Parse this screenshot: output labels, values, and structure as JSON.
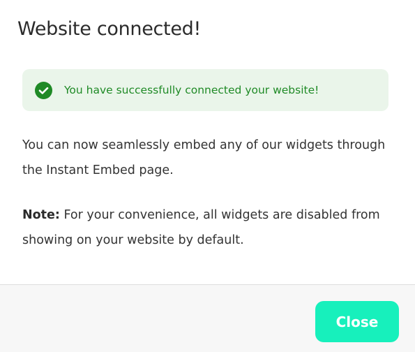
{
  "dialog": {
    "title": "Website connected!",
    "alert": {
      "icon": "check-circle-icon",
      "text": "You have successfully connected your website!",
      "text_color": "#1f8a26",
      "background_color": "#eaf5ea"
    },
    "body": {
      "paragraph_1": "You can now seamlessly embed any of our widgets through the Instant Embed page.",
      "note_label": "Note:",
      "note_text": " For your convenience, all widgets are disabled from showing on your website by default."
    },
    "footer": {
      "close_label": "Close",
      "close_color": "#17f0bc"
    }
  }
}
